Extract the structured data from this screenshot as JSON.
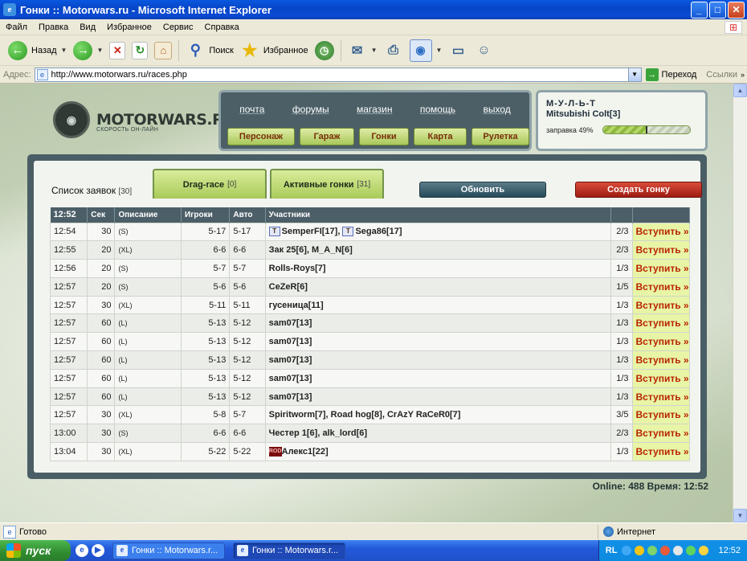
{
  "window": {
    "title": "Гонки :: Motorwars.ru - Microsoft Internet Explorer"
  },
  "menu": [
    "Файл",
    "Правка",
    "Вид",
    "Избранное",
    "Сервис",
    "Справка"
  ],
  "toolbar": {
    "back": "Назад",
    "search": "Поиск",
    "favorites": "Избранное"
  },
  "address": {
    "label": "Адрес:",
    "url": "http://www.motorwars.ru/races.php",
    "go": "Переход",
    "links": "Ссылки"
  },
  "site": {
    "logo_name": "MOTORWARS.RU",
    "logo_tagline": "СКОРОСТЬ ОН-ЛАЙН",
    "nav_top": [
      "почта",
      "форумы",
      "магазин",
      "помощь",
      "выход"
    ],
    "nav_buttons": [
      "Персонаж",
      "Гараж",
      "Гонки",
      "Карта",
      "Рулетка"
    ],
    "user": {
      "name": "М-У-Л-Ь-Т",
      "car": "Mitsubishi Colt[3]",
      "fuel_label": "заправка 49%",
      "fuel_fraction": 0.49
    },
    "tabs": {
      "list_label": "Список заявок",
      "list_count": "[30]",
      "drag_label": "Drag-race",
      "drag_count": "[0]",
      "active_label": "Активные гонки",
      "active_count": "[31]"
    },
    "buttons": {
      "refresh": "Обновить",
      "create": "Создать гонку"
    },
    "table": {
      "headers": [
        "12:52",
        "Сек",
        "Описание",
        "Игроки",
        "Авто",
        "Участники"
      ],
      "rows": [
        {
          "time": "12:54",
          "sec": "30",
          "desc": "(S)",
          "players": "5-17",
          "auto": "5-17",
          "parts": [
            {
              "clan": "T",
              "name": "SemperFI[17]"
            },
            {
              "clan": "T",
              "name": "Sega86[17]"
            }
          ],
          "ratio": "2/3",
          "join": "Вступить »"
        },
        {
          "time": "12:55",
          "sec": "20",
          "desc": "(XL)",
          "players": "6-6",
          "auto": "6-6",
          "parts": [
            {
              "name": "Зак 25[6]"
            },
            {
              "name": "M_A_N[6]"
            }
          ],
          "ratio": "2/3",
          "join": "Вступить »"
        },
        {
          "time": "12:56",
          "sec": "20",
          "desc": "(S)",
          "players": "5-7",
          "auto": "5-7",
          "parts": [
            {
              "name": "Rolls-Roys[7]"
            }
          ],
          "ratio": "1/3",
          "join": "Вступить »"
        },
        {
          "time": "12:57",
          "sec": "20",
          "desc": "(S)",
          "players": "5-6",
          "auto": "5-6",
          "parts": [
            {
              "name": "CeZeR[6]"
            }
          ],
          "ratio": "1/5",
          "join": "Вступить »"
        },
        {
          "time": "12:57",
          "sec": "30",
          "desc": "(XL)",
          "players": "5-11",
          "auto": "5-11",
          "parts": [
            {
              "name": "гусеница[11]"
            }
          ],
          "ratio": "1/3",
          "join": "Вступить »"
        },
        {
          "time": "12:57",
          "sec": "60",
          "desc": "(L)",
          "players": "5-13",
          "auto": "5-12",
          "parts": [
            {
              "name": "sam07[13]"
            }
          ],
          "ratio": "1/3",
          "join": "Вступить »"
        },
        {
          "time": "12:57",
          "sec": "60",
          "desc": "(L)",
          "players": "5-13",
          "auto": "5-12",
          "parts": [
            {
              "name": "sam07[13]"
            }
          ],
          "ratio": "1/3",
          "join": "Вступить »"
        },
        {
          "time": "12:57",
          "sec": "60",
          "desc": "(L)",
          "players": "5-13",
          "auto": "5-12",
          "parts": [
            {
              "name": "sam07[13]"
            }
          ],
          "ratio": "1/3",
          "join": "Вступить »"
        },
        {
          "time": "12:57",
          "sec": "60",
          "desc": "(L)",
          "players": "5-13",
          "auto": "5-12",
          "parts": [
            {
              "name": "sam07[13]"
            }
          ],
          "ratio": "1/3",
          "join": "Вступить »"
        },
        {
          "time": "12:57",
          "sec": "60",
          "desc": "(L)",
          "players": "5-13",
          "auto": "5-12",
          "parts": [
            {
              "name": "sam07[13]"
            }
          ],
          "ratio": "1/3",
          "join": "Вступить »"
        },
        {
          "time": "12:57",
          "sec": "30",
          "desc": "(XL)",
          "players": "5-8",
          "auto": "5-7",
          "parts": [
            {
              "name": "Spiritworm[7]"
            },
            {
              "name": "Road hog[8]"
            },
            {
              "name": "CrAzY RaCeR0[7]"
            }
          ],
          "ratio": "3/5",
          "join": "Вступить »"
        },
        {
          "time": "13:00",
          "sec": "30",
          "desc": "(S)",
          "players": "6-6",
          "auto": "6-6",
          "parts": [
            {
              "name": "Честер 1[6]"
            },
            {
              "name": "alk_lord[6]"
            }
          ],
          "ratio": "2/3",
          "join": "Вступить »"
        },
        {
          "time": "13:04",
          "sec": "30",
          "desc": "(XL)",
          "players": "5-22",
          "auto": "5-22",
          "parts": [
            {
              "clan": "ROD",
              "name": "Алекс1[22]"
            }
          ],
          "ratio": "1/3",
          "join": "Вступить »"
        }
      ]
    },
    "online": "Online: 488  Время: 12:52"
  },
  "status": {
    "text": "Готово",
    "zone": "Интернет"
  },
  "taskbar": {
    "start": "пуск",
    "tasks": [
      "Гонки :: Motorwars.r...",
      "Гонки :: Motorwars.r..."
    ],
    "lang": "RL",
    "clock": "12:52"
  }
}
